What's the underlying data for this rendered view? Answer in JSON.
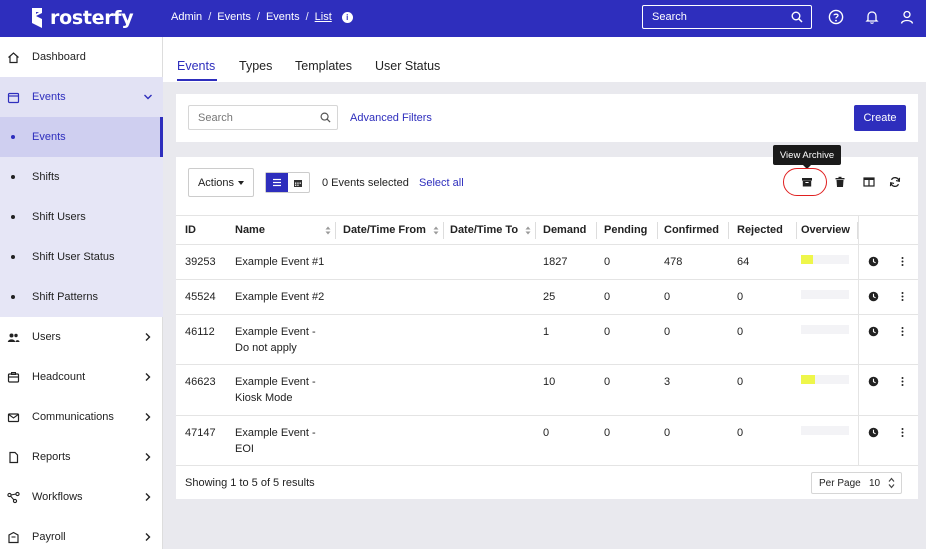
{
  "brand": {
    "name": "rosterfy"
  },
  "breadcrumb": [
    "Admin",
    "Events",
    "Events",
    "List"
  ],
  "topbar": {
    "search_placeholder": "Search"
  },
  "sidebar": {
    "items": [
      {
        "label": "Dashboard",
        "icon": "home-icon"
      },
      {
        "label": "Events",
        "icon": "calendar-icon",
        "expanded": true
      },
      {
        "label": "Events",
        "sub": true,
        "active": true
      },
      {
        "label": "Shifts",
        "sub": true
      },
      {
        "label": "Shift Users",
        "sub": true
      },
      {
        "label": "Shift User Status",
        "sub": true
      },
      {
        "label": "Shift Patterns",
        "sub": true
      },
      {
        "label": "Users",
        "icon": "users-icon"
      },
      {
        "label": "Headcount",
        "icon": "headcount-icon"
      },
      {
        "label": "Communications",
        "icon": "mail-icon"
      },
      {
        "label": "Reports",
        "icon": "document-icon"
      },
      {
        "label": "Workflows",
        "icon": "workflow-icon"
      },
      {
        "label": "Payroll",
        "icon": "payroll-icon"
      }
    ]
  },
  "tabs": [
    {
      "label": "Events",
      "active": true
    },
    {
      "label": "Types"
    },
    {
      "label": "Templates"
    },
    {
      "label": "User Status"
    }
  ],
  "filters": {
    "search_placeholder": "Search",
    "advanced_label": "Advanced Filters",
    "create_label": "Create"
  },
  "toolbar": {
    "actions_label": "Actions",
    "selected_text": "0 Events selected",
    "select_all_label": "Select all",
    "tooltip": "View Archive"
  },
  "table": {
    "columns": [
      "ID",
      "Name",
      "Date/Time From",
      "Date/Time To",
      "Demand",
      "Pending",
      "Confirmed",
      "Rejected",
      "Overview"
    ],
    "rows": [
      {
        "id": "39253",
        "name": [
          "Example Event #1"
        ],
        "from": "",
        "to": "",
        "demand": "1827",
        "pending": "0",
        "confirmed": "478",
        "rejected": "64",
        "overview_fill": 0.26
      },
      {
        "id": "45524",
        "name": [
          "Example Event #2"
        ],
        "from": "",
        "to": "",
        "demand": "25",
        "pending": "0",
        "confirmed": "0",
        "rejected": "0",
        "overview_fill": 0
      },
      {
        "id": "46112",
        "name": [
          "Example Event -",
          "Do not apply"
        ],
        "from": "",
        "to": "",
        "demand": "1",
        "pending": "0",
        "confirmed": "0",
        "rejected": "0",
        "overview_fill": 0
      },
      {
        "id": "46623",
        "name": [
          "Example Event -",
          "Kiosk Mode"
        ],
        "from": "",
        "to": "",
        "demand": "10",
        "pending": "0",
        "confirmed": "3",
        "rejected": "0",
        "overview_fill": 0.3
      },
      {
        "id": "47147",
        "name": [
          "Example Event -",
          "EOI"
        ],
        "from": "",
        "to": "",
        "demand": "0",
        "pending": "0",
        "confirmed": "0",
        "rejected": "0",
        "overview_fill": 0
      }
    ],
    "footer": "Showing 1 to 5 of 5 results",
    "per_page_label": "Per Page",
    "per_page_value": "10"
  },
  "colors": {
    "brand": "#2e2ebd",
    "annotation_ring": "#e02020",
    "overview_fill": "#eef64a"
  }
}
